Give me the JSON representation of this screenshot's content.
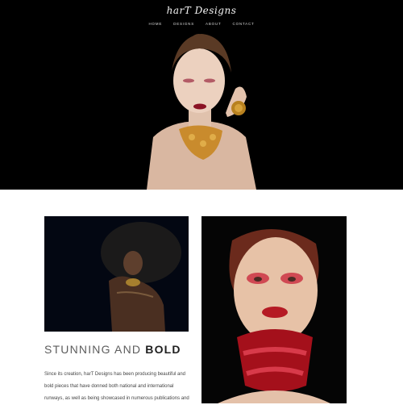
{
  "brand": {
    "logo_text": "harT Designs"
  },
  "nav": {
    "items": [
      "HOME",
      "DESIGNS",
      "ABOUT",
      "CONTACT"
    ]
  },
  "feature": {
    "headline_light": "STUNNING AND ",
    "headline_bold": "BOLD",
    "body": "Since its creation, harT Designs has been producing beautiful and bold pieces that have donned both national and international runways, as well as being showcased in numerous publications and"
  },
  "colors": {
    "hero_bg": "#000000",
    "page_bg": "#ffffff",
    "accent_gold": "#c98b2d",
    "accent_red": "#b0101b"
  }
}
